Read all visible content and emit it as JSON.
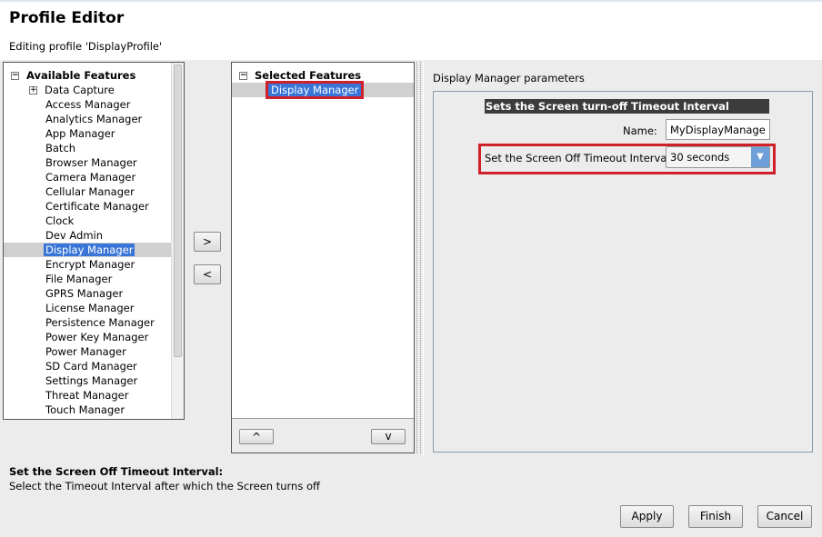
{
  "header": {
    "title": "Profile Editor",
    "subtitle": "Editing profile 'DisplayProfile'"
  },
  "available": {
    "title": "Available Features",
    "items": [
      "Data Capture",
      "Access Manager",
      "Analytics Manager",
      "App Manager",
      "Batch",
      "Browser Manager",
      "Camera Manager",
      "Cellular Manager",
      "Certificate Manager",
      "Clock",
      "Dev Admin",
      "Display Manager",
      "Encrypt Manager",
      "File Manager",
      "GPRS Manager",
      "License Manager",
      "Persistence Manager",
      "Power Key Manager",
      "Power Manager",
      "SD Card Manager",
      "Settings Manager",
      "Threat Manager",
      "Touch Manager"
    ],
    "selected": "Display Manager"
  },
  "move": {
    "add": ">",
    "remove": "<"
  },
  "selected": {
    "title": "Selected Features",
    "items": [
      "Display Manager"
    ],
    "up": "^",
    "down": "v"
  },
  "params": {
    "title": "Display Manager parameters",
    "section": "Sets the Screen turn-off Timeout Interval",
    "name_label": "Name:",
    "name_value": "MyDisplayManager",
    "timeout_label": "Set the Screen Off Timeout Interval:",
    "timeout_value": "30 seconds"
  },
  "help": {
    "title": "Set the Screen Off Timeout Interval:",
    "text": "Select the Timeout Interval after which the Screen turns off"
  },
  "buttons": {
    "apply": "Apply",
    "finish": "Finish",
    "cancel": "Cancel"
  },
  "colors": {
    "highlight": "#3875d7",
    "annotation": "#d0202a"
  }
}
